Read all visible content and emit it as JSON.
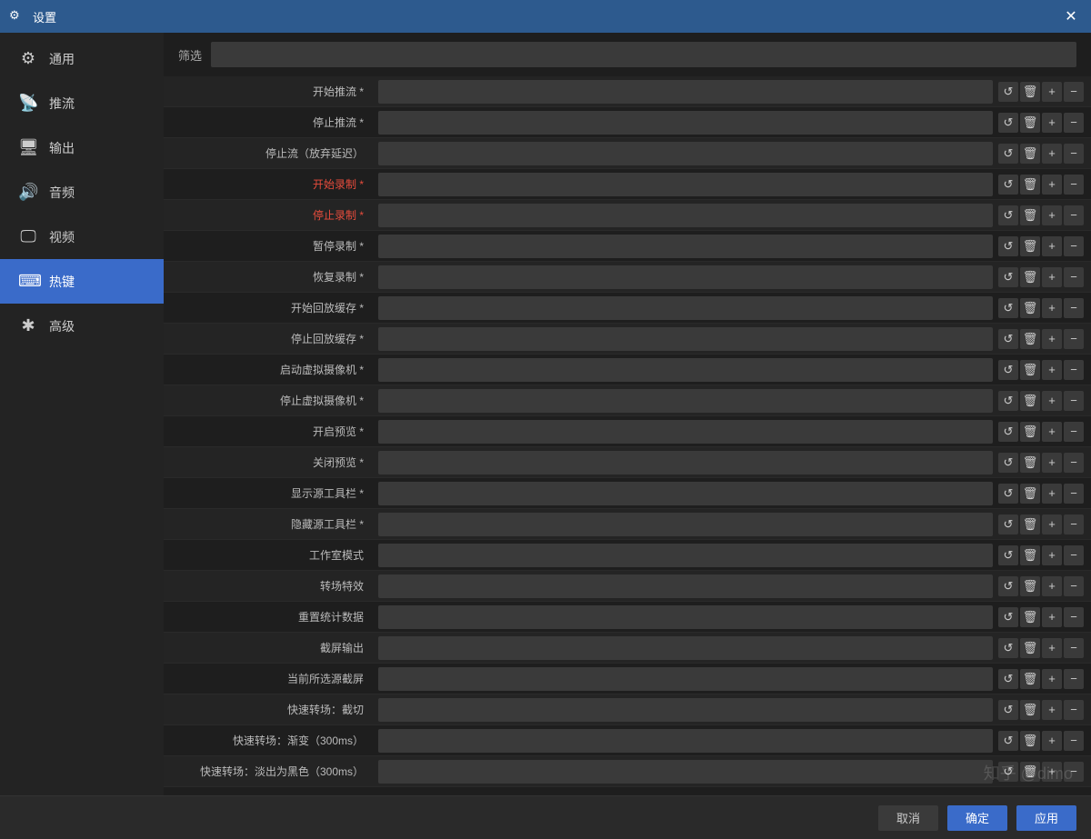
{
  "titleBar": {
    "title": "设置",
    "closeLabel": "✕"
  },
  "sidebar": {
    "items": [
      {
        "id": "general",
        "label": "通用",
        "icon": "⚙",
        "active": false
      },
      {
        "id": "stream",
        "label": "推流",
        "icon": "📡",
        "active": false
      },
      {
        "id": "output",
        "label": "输出",
        "icon": "🖥",
        "active": false
      },
      {
        "id": "audio",
        "label": "音频",
        "icon": "🔊",
        "active": false
      },
      {
        "id": "video",
        "label": "视频",
        "icon": "🖵",
        "active": false
      },
      {
        "id": "hotkeys",
        "label": "热键",
        "icon": "⌨",
        "active": true
      },
      {
        "id": "advanced",
        "label": "高级",
        "icon": "✱",
        "active": false
      }
    ]
  },
  "filter": {
    "label": "筛选",
    "placeholder": ""
  },
  "hotkeys": [
    {
      "name": "开始推流 *",
      "red": false
    },
    {
      "name": "停止推流 *",
      "red": false
    },
    {
      "name": "停止流（放弃延迟）",
      "red": false
    },
    {
      "name": "开始录制 *",
      "red": true
    },
    {
      "name": "停止录制 *",
      "red": true
    },
    {
      "name": "暂停录制 *",
      "red": false
    },
    {
      "name": "恢复录制 *",
      "red": false
    },
    {
      "name": "开始回放缓存 *",
      "red": false
    },
    {
      "name": "停止回放缓存 *",
      "red": false
    },
    {
      "name": "启动虚拟摄像机 *",
      "red": false
    },
    {
      "name": "停止虚拟摄像机 *",
      "red": false
    },
    {
      "name": "开启预览 *",
      "red": false
    },
    {
      "name": "关闭预览 *",
      "red": false
    },
    {
      "name": "显示源工具栏 *",
      "red": false
    },
    {
      "name": "隐藏源工具栏 *",
      "red": false
    },
    {
      "name": "工作室模式",
      "red": false
    },
    {
      "name": "转场特效",
      "red": false
    },
    {
      "name": "重置统计数据",
      "red": false
    },
    {
      "name": "截屏输出",
      "red": false
    },
    {
      "name": "当前所选源截屏",
      "red": false
    },
    {
      "name": "快速转场：截切",
      "red": false
    },
    {
      "name": "快速转场：渐变（300ms）",
      "red": false
    },
    {
      "name": "快速转场：淡出为黑色（300ms）",
      "red": false
    }
  ],
  "actions": {
    "resetIcon": "↺",
    "deleteIcon": "🗑",
    "addIcon": "+",
    "removeIcon": "−"
  },
  "bottomBar": {
    "confirm": "确定",
    "cancel": "取消",
    "apply": "应用"
  },
  "watermark": "知乎 @dimo"
}
